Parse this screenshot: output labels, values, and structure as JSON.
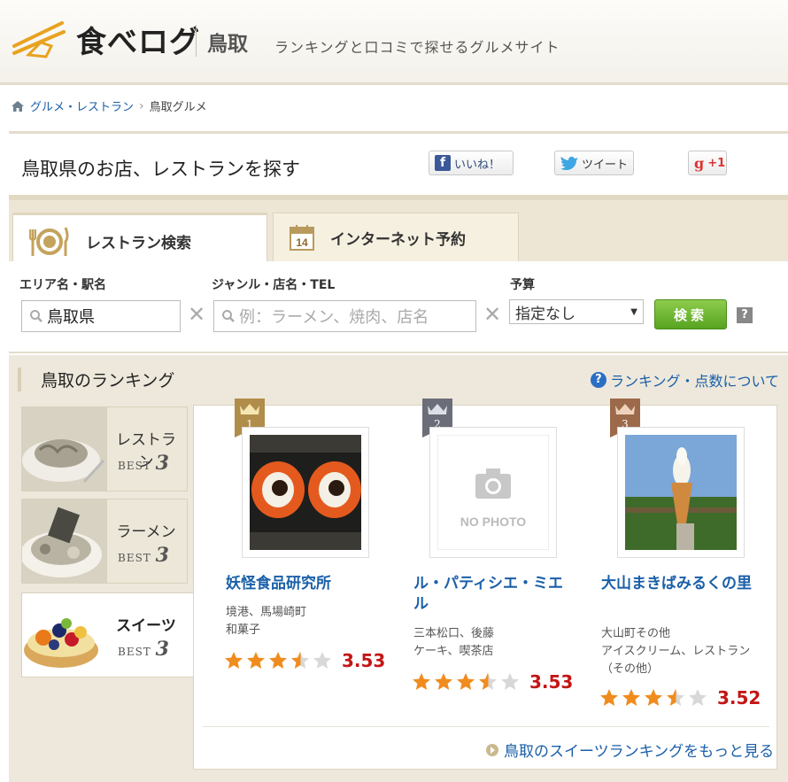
{
  "header": {
    "logo": "食べログ",
    "area": "鳥取",
    "tagline": "ランキングと口コミで探せるグルメサイト"
  },
  "breadcrumb": {
    "items": [
      "グルメ・レストラン",
      "鳥取グルメ"
    ]
  },
  "title": "鳥取県のお店、レストランを探す",
  "social": {
    "facebook": "いいね！",
    "twitter": "ツイート",
    "gplus": "+1"
  },
  "tabs": {
    "restaurant": "レストラン検索",
    "reservation": "インターネット予約",
    "calendar_number": "14"
  },
  "search": {
    "area_label": "エリア名・駅名",
    "area_value": "鳥取県",
    "genre_label": "ジャンル・店名・TEL",
    "genre_placeholder": "例：ラーメン、焼肉、店名",
    "budget_label": "予算",
    "budget_value": "指定なし",
    "button": "検索",
    "help": "?"
  },
  "ranking": {
    "heading": "鳥取のランキング",
    "about": "ランキング・点数について",
    "categories": [
      {
        "label": "レストラン",
        "best": "BEST",
        "num": "3"
      },
      {
        "label": "ラーメン",
        "best": "BEST",
        "num": "3"
      },
      {
        "label": "スイーツ",
        "best": "BEST",
        "num": "3"
      }
    ],
    "items": [
      {
        "rank": "1",
        "name": "妖怪食品研究所",
        "area": "境港、馬場崎町",
        "genre": "和菓子",
        "rating": 3.53,
        "score": "3.53",
        "color": "#b08d4a"
      },
      {
        "rank": "2",
        "name": "ル・パティシエ・ミエル",
        "area": "三本松口、後藤",
        "genre": "ケーキ、喫茶店",
        "rating": 3.53,
        "score": "3.53",
        "color": "#6b6e78",
        "no_photo": "NO PHOTO"
      },
      {
        "rank": "3",
        "name": "大山まきばみるくの里",
        "area": "大山町その他",
        "genre": "アイスクリーム、レストラン（その他）",
        "rating": 3.52,
        "score": "3.52",
        "color": "#9c6a4a"
      }
    ],
    "more": "鳥取のスイーツランキングをもっと見る"
  }
}
